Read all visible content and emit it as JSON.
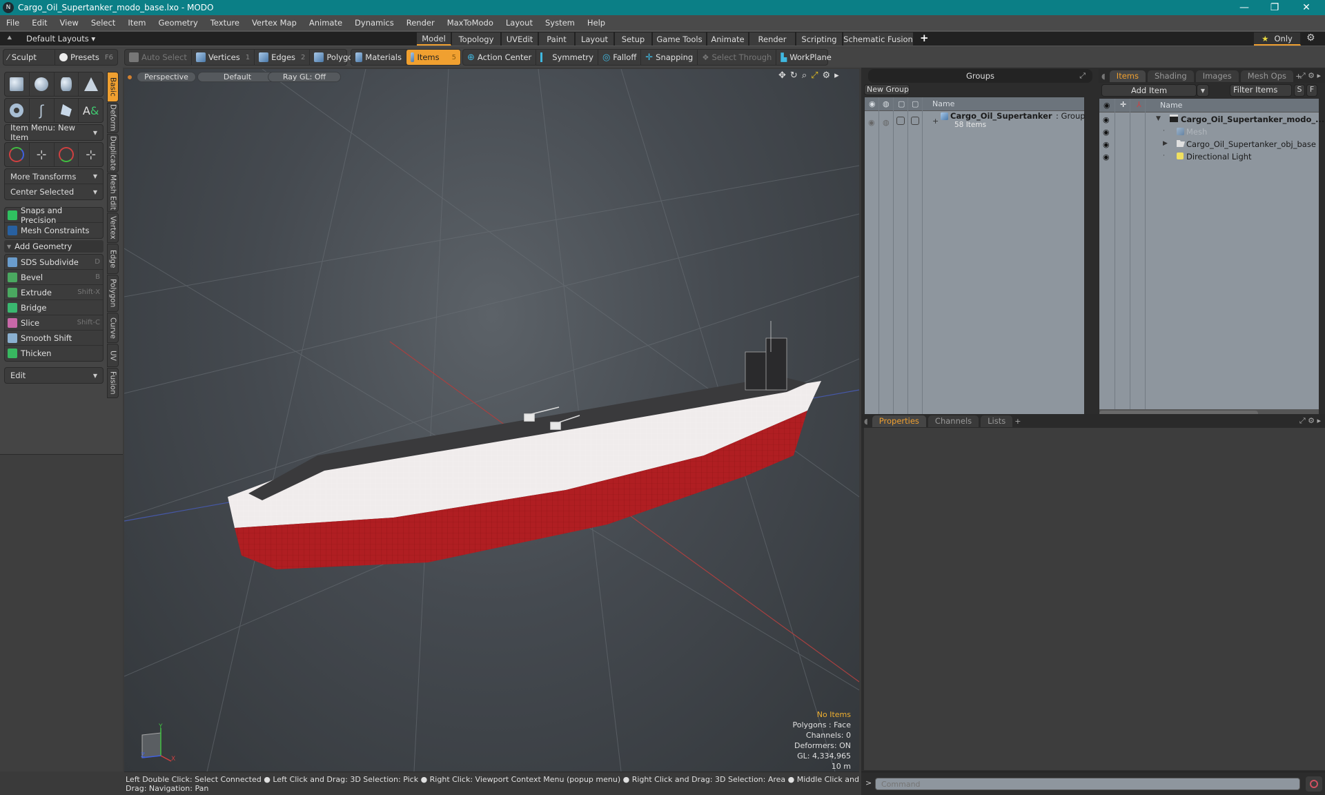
{
  "window": {
    "title": "Cargo_Oil_Supertanker_modo_base.lxo - MODO",
    "controls": {
      "minimize": "—",
      "maximize": "❐",
      "close": "✕"
    }
  },
  "menu": [
    "File",
    "Edit",
    "View",
    "Select",
    "Item",
    "Geometry",
    "Texture",
    "Vertex Map",
    "Animate",
    "Dynamics",
    "Render",
    "MaxToModo",
    "Layout",
    "System",
    "Help"
  ],
  "layoutbar": {
    "layouts_label": "Default Layouts ▾",
    "tabs": [
      "Model",
      "Topology",
      "UVEdit",
      "Paint",
      "Layout",
      "Setup",
      "Game Tools",
      "Animate",
      "Render",
      "Scripting",
      "Schematic Fusion"
    ],
    "active_tab": "Model",
    "add": "+",
    "only_label": "Only"
  },
  "toolbar": {
    "sculpt": "Sculpt",
    "presets": "Presets",
    "presets_key": "F6",
    "auto_select": "Auto Select",
    "vertices": "Vertices",
    "vertices_key": "1",
    "edges": "Edges",
    "edges_key": "2",
    "polygons": "Polygons",
    "materials": "Materials",
    "items": "Items",
    "items_key": "5",
    "action_center": "Action Center",
    "symmetry": "Symmetry",
    "falloff": "Falloff",
    "snapping": "Snapping",
    "select_through": "Select Through",
    "workplane": "WorkPlane"
  },
  "leftpanel": {
    "item_menu": "Item Menu: New Item",
    "more_transforms": "More Transforms",
    "center_selected": "Center Selected",
    "snaps": "Snaps and Precision",
    "mesh_constraints": "Mesh Constraints",
    "add_geometry": "Add Geometry",
    "tools": [
      {
        "label": "SDS Subdivide",
        "key": "D",
        "color": "#6a9ccc"
      },
      {
        "label": "Bevel",
        "key": "B",
        "color": "#4aa860"
      },
      {
        "label": "Extrude",
        "key": "Shift-X",
        "color": "#4aa860"
      },
      {
        "label": "Bridge",
        "key": "",
        "color": "#3ab870"
      },
      {
        "label": "Slice",
        "key": "Shift-C",
        "color": "#c868a8"
      },
      {
        "label": "Smooth Shift",
        "key": "",
        "color": "#8ab0d0"
      },
      {
        "label": "Thicken",
        "key": "",
        "color": "#38b860"
      }
    ],
    "edit": "Edit",
    "vtabs": [
      "Basic",
      "Deform",
      "Duplicate",
      "Mesh Edit",
      "Vertex",
      "Edge",
      "Polygon",
      "Curve",
      "UV",
      "Fusion"
    ]
  },
  "viewport": {
    "view": "Perspective",
    "shading": "Default",
    "raygl": "Ray GL: Off",
    "info": {
      "selection": "No Items",
      "polygons": "Polygons : Face",
      "channels": "Channels: 0",
      "deformers": "Deformers: ON",
      "gl": "GL: 4,334,965",
      "scale": "10 m"
    },
    "axis": {
      "x": "X",
      "y": "Y",
      "z": "Z"
    }
  },
  "groups": {
    "title": "Groups",
    "new_group": "New Group",
    "name_col": "Name",
    "row": {
      "name": "Cargo_Oil_Supertanker",
      "type": ": Group",
      "count": "58 Items"
    }
  },
  "items": {
    "tabs": [
      "Items",
      "Shading",
      "Images",
      "Mesh Ops"
    ],
    "active_tab": "Items",
    "add_item": "Add Item",
    "filter": "Filter Items",
    "s": "S",
    "f": "F",
    "name_col": "Name",
    "rows": [
      {
        "name": "Cargo_Oil_Supertanker_modo_...",
        "bold": true
      },
      {
        "name": "Mesh",
        "dim": true
      },
      {
        "name": "Cargo_Oil_Supertanker_obj_base"
      },
      {
        "name": "Directional Light"
      }
    ]
  },
  "properties": {
    "tabs": [
      "Properties",
      "Channels",
      "Lists"
    ],
    "active_tab": "Properties"
  },
  "status": {
    "hints": "Left Double Click: Select Connected ● Left Click and Drag: 3D Selection: Pick ● Right Click: Viewport Context Menu (popup menu) ● Right Click and Drag: 3D Selection: Area ● Middle Click and Drag: Navigation: Pan"
  },
  "command": {
    "placeholder": "Command",
    "prompt": ">"
  },
  "colors": {
    "accent": "#f0a030",
    "titlebar": "#0b7f86",
    "hull_red": "#b01e22"
  }
}
